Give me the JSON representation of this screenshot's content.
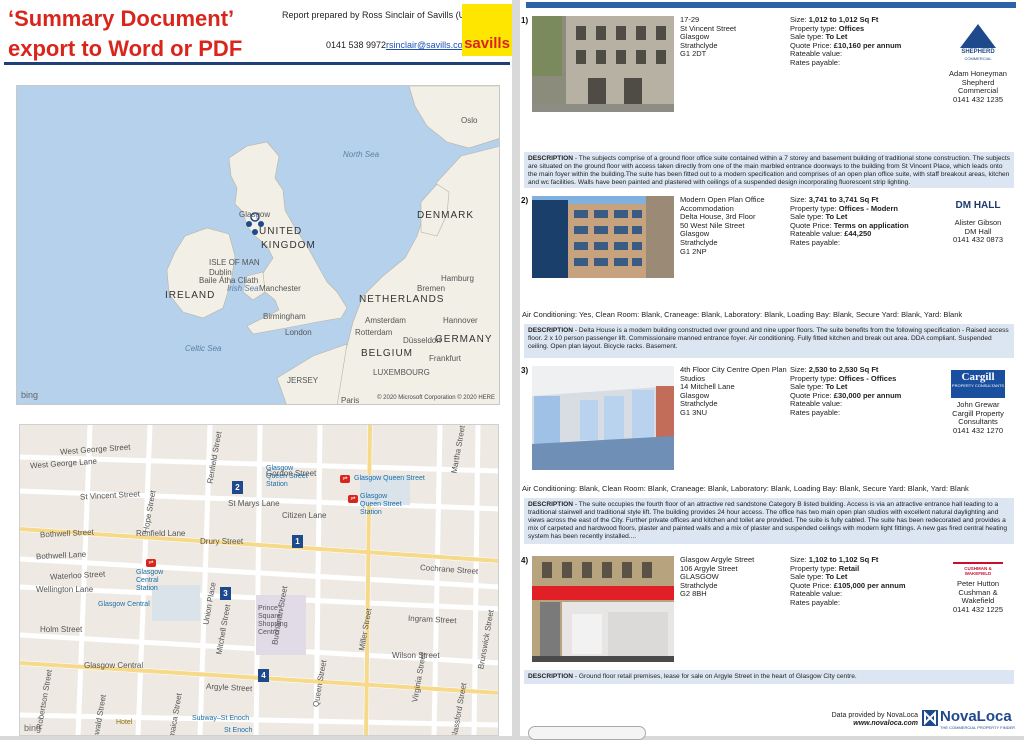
{
  "header": {
    "title": "‘Summary Document’ export to Word or PDF",
    "report_by": "Report prepared by Ross Sinclair of Savills (UK) Ltd",
    "phone": "0141 538 9972",
    "email": "rsinclair@savills.com",
    "logo_text": "savills"
  },
  "overview_map": {
    "labels": {
      "north_sea": "North Sea",
      "uk1": "UNITED",
      "uk2": "KINGDOM",
      "denmark": "DENMARK",
      "ireland": "IRELAND",
      "netherlands": "NETHERLANDS",
      "germany": "GERMANY",
      "belgium": "BELGIUM",
      "celtic_sea": "Celtic Sea",
      "irish_sea": "Irish Sea",
      "isle_of_man": "ISLE OF MAN",
      "dublin": "Dublin",
      "baile": "Baile Átha Cliath",
      "glasgow": "Glasgow",
      "manchester": "Manchester",
      "birmingham": "Birmingham",
      "london": "London",
      "hamburg": "Hamburg",
      "bremen": "Bremen",
      "amsterdam": "Amsterdam",
      "hannover": "Hannover",
      "rotterdam": "Rotterdam",
      "dusseldorf": "Düsseldorf",
      "frankfurt": "Frankfurt",
      "luxembourg": "LUXEMBOURG",
      "jersey": "JERSEY",
      "paris": "Paris",
      "oslo": "Oslo"
    },
    "bing": "bing",
    "copyright": "© 2020 Microsoft Corporation © 2020 HERE"
  },
  "street_map": {
    "streets": {
      "west_george": "West George Street",
      "west_george2": "West George Lane",
      "st_vincent": "St Vincent Street",
      "st_marys": "St Marys Lane",
      "bothwell": "Bothwell Street",
      "bothwell_lane": "Bothwell Lane",
      "waterloo": "Waterloo Street",
      "wellington_lane": "Wellington Lane",
      "holm": "Holm Street",
      "renfield_lane": "Renfield Lane",
      "drury": "Drury Street",
      "gordon": "Gordon Street",
      "citizen": "Citizen Lane",
      "cochrane": "Cochrane Street",
      "argyle": "Argyle Street",
      "ingram": "Ingram Street",
      "wilson": "Wilson Street",
      "hope": "Hope Street",
      "renfield": "Renfield Street",
      "union": "Union Place",
      "mitchell": "Mitchell Street",
      "buchanan": "Buchanan Street",
      "queen": "Queen Street",
      "miller": "Miller Street",
      "virginia": "Virginia Street",
      "brunswick": "Brunswick Street",
      "glassford": "Glassford Street",
      "martha": "Martha Street",
      "robertson": "Robertson Street",
      "oswald": "Oswald Street",
      "jamaica": "Jamaica Street",
      "dixon": "Dixon Street",
      "glasgow_central2": "Glasgow Central"
    },
    "stations": {
      "queen_st": "Glasgow\nQueen Street\nStation",
      "queen_st_top": "Glasgow Queen Street",
      "queen_st_2": "Glasgow\nQueen Street\nStation",
      "central": "Glasgow\nCentral\nStation",
      "central_2": "Glasgow Central",
      "squares": "Prince's\nSquare\nShopping\nCentre",
      "subway": "Subway–St Enoch",
      "st_enoch": "St Enoch",
      "hotel": "Hotel"
    },
    "pins": [
      "1",
      "2",
      "3",
      "4"
    ],
    "bing": "bing"
  },
  "listings": [
    {
      "num": "1)",
      "address": [
        "17-29",
        "St Vincent Street",
        "Glasgow",
        "Strathclyde",
        "G1 2DT"
      ],
      "size": "Size:",
      "size_value": "1,012 to 1,012 Sq Ft",
      "type_label": "Property type:",
      "type_value": "Offices",
      "sale_label": "Sale type:",
      "sale_value": "To Let",
      "quote_label": "Quote Price:",
      "quote_value": "£10,160 per annum",
      "rateable_label": "Rateable value:",
      "rateable_value": "",
      "rates_label": "Rates payable:",
      "agent_logo": "SHEPHERD",
      "agent_logo_sub": "COMMERCIAL",
      "agent": [
        "Adam Honeyman",
        "Shepherd",
        "Commercial",
        "0141 432 1235"
      ],
      "amenities": "",
      "desc_label": "DESCRIPTION",
      "desc": " - The subjects comprise of a ground floor office suite contained within a 7 storey and basement building of traditional stone construction. The subjects are situated on the ground floor with access taken directly from one of the main marbled entrance doorways to the building from St Vincent Place, which leads onto the main foyer within the building.The suite has been fitted out to a modern specification and comprises of an open plan office suite, with staff breakout areas, kitchen and wc facilities. Walls have been painted and plastered with ceilings of a suspended design incorporating fluorescent strip lighting."
    },
    {
      "num": "2)",
      "address": [
        "Modern Open Plan Office",
        "Accommodation",
        "Delta House, 3rd Floor",
        "50 West Nile Street",
        "Glasgow",
        "Strathclyde",
        "G1 2NP"
      ],
      "size": "Size:",
      "size_value": "3,741 to 3,741 Sq Ft",
      "type_label": "Property type:",
      "type_value": "Offices - Modern",
      "sale_label": "Sale type:",
      "sale_value": "To Let",
      "quote_label": "Quote Price:",
      "quote_value": "Terms on application",
      "rateable_label": "Rateable value:",
      "rateable_value": "£44,250",
      "rates_label": "Rates payable:",
      "agent_logo": "DM HALL",
      "agent_logo_sub": "",
      "agent": [
        "Alister Gibson",
        "DM Hall",
        "0141 432 0873"
      ],
      "amenities": "Air Conditioning: Yes, Clean Room: Blank, Craneage: Blank, Laboratory: Blank, Loading Bay: Blank, Secure Yard: Blank, Yard: Blank",
      "desc_label": "DESCRIPTION",
      "desc": " - Delta House is a modern building constructed over ground and nine upper floors. The suite benefits from the following specification - Raised access floor. 2 x 10 person passenger lift. Commissionaire manned entrance foyer. Air conditioning. Fully fitted kitchen and break out area. DDA compliant. Suspended ceiling. Open plan layout. Bicycle racks. Basement."
    },
    {
      "num": "3)",
      "address": [
        "4th Floor City Centre Open Plan",
        "Studios",
        "14 Mitchell Lane",
        "Glasgow",
        "Strathclyde",
        "G1 3NU"
      ],
      "size": "Size:",
      "size_value": "2,530 to 2,530 Sq Ft",
      "type_label": "Property type:",
      "type_value": "Offices - Offices",
      "sale_label": "Sale type:",
      "sale_value": "To Let",
      "quote_label": "Quote Price:",
      "quote_value": "£30,000 per annum",
      "rateable_label": "Rateable value:",
      "rateable_value": "",
      "rates_label": "Rates payable:",
      "agent_logo": "Cargill",
      "agent_logo_sub": "PROPERTY CONSULTANTS",
      "agent": [
        "John Grewar",
        "Cargill Property",
        "Consultants",
        "0141 432 1270"
      ],
      "amenities": "Air Conditioning: Blank, Clean Room: Blank, Craneage: Blank, Laboratory: Blank, Loading Bay: Blank, Secure Yard: Blank, Yard: Blank",
      "desc_label": "DESCRIPTION",
      "desc": " - The suite occupies the fourth floor of an attractive red sandstone Category B listed building. Access is via an attractive entrance hall leading to a traditional stairwell and traditional style lift. The building provides 24 hour access. The office has two main open plan studios with excellent natural daylighting and views across the east of the City. Further private offices and kitchen and toilet are provided. The suite is fully cabled. The suite has been redecorated and provides a mix of carpeted and hardwood floors, plaster and painted walls and a mix of plaster and suspended ceilings with modern light fittings. A new gas fired central heating system has been recently installed...."
    },
    {
      "num": "4)",
      "address": [
        "Glasgow Argyle Street",
        "106 Argyle Street",
        "GLASGOW",
        "Strathclyde",
        "G2 8BH"
      ],
      "size": "Size:",
      "size_value": "1,102 to 1,102 Sq Ft",
      "type_label": "Property type:",
      "type_value": "Retail",
      "sale_label": "Sale type:",
      "sale_value": "To Let",
      "quote_label": "Quote Price:",
      "quote_value": "£105,000 per annum",
      "rateable_label": "Rateable value:",
      "rateable_value": "",
      "rates_label": "Rates payable:",
      "agent_logo": "CUSHMAN & WAKEFIELD",
      "agent_logo_sub": "",
      "agent": [
        "Peter Hutton",
        "Cushman &",
        "Wakefield",
        "0141 432 1225"
      ],
      "amenities": "",
      "desc_label": "DESCRIPTION",
      "desc": " - Ground floor retail premises, lease for sale on Argyle Street in the heart of Glasgow City centre."
    }
  ],
  "footer": {
    "line1": "Data provided by NovaLoca",
    "line2": "www.novaloca.com",
    "logo": "NovaLoca",
    "logo_sub": "THE COMMERCIAL PROPERTY FINDER"
  },
  "colors": {
    "title_red": "#d9261c",
    "savills_yellow": "#ffe600",
    "rule_blue": "#1f3f7a",
    "desc_bg": "#dce5f2"
  }
}
